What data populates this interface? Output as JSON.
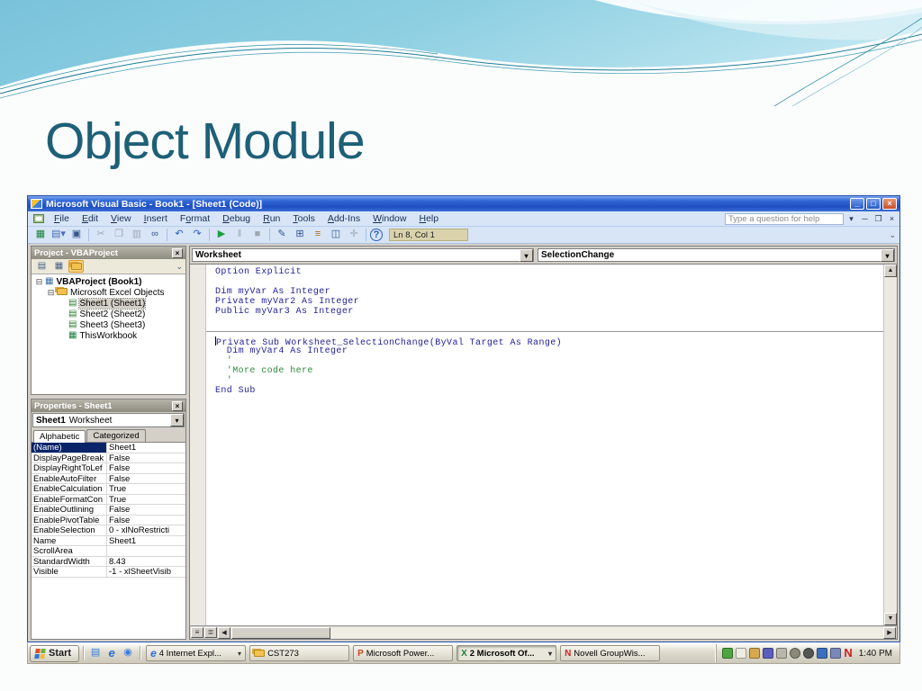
{
  "slide": {
    "title": "Object Module"
  },
  "colors": {
    "title_text": "#1d6077",
    "wave_blue_dark": "#6ab5d2",
    "wave_blue_light": "#bfe6f1",
    "wave_line": "#1f7d95",
    "titlebar_blue": "#1e4fc2",
    "menu_bg": "#d7e5f7",
    "panel_gray": "#d4d0c8",
    "code_keyword": "#22229a",
    "code_comment": "#2e8b3a",
    "selected_property": "#0a246a",
    "ln_box_bg": "#d9d2ab"
  },
  "vb": {
    "window_title": "Microsoft Visual Basic - Book1 - [Sheet1 (Code)]",
    "window_buttons": {
      "minimize": "_",
      "maximize": "□",
      "close": "×"
    },
    "menus": [
      {
        "label": "File",
        "u": 0
      },
      {
        "label": "Edit",
        "u": 0
      },
      {
        "label": "View",
        "u": 0
      },
      {
        "label": "Insert",
        "u": 0
      },
      {
        "label": "Format",
        "u": 1
      },
      {
        "label": "Debug",
        "u": 0
      },
      {
        "label": "Run",
        "u": 0
      },
      {
        "label": "Tools",
        "u": 0
      },
      {
        "label": "Add-Ins",
        "u": 0
      },
      {
        "label": "Window",
        "u": 0
      },
      {
        "label": "Help",
        "u": 0
      }
    ],
    "help_box_placeholder": "Type a question for help",
    "child_window_buttons": [
      "─",
      "❐",
      "×"
    ],
    "toolbar": {
      "buttons": [
        {
          "name": "view-excel-icon",
          "glyph": "▦",
          "color": "#1a7f3c",
          "enabled": true
        },
        {
          "name": "insert-userform-icon",
          "glyph": "▤",
          "color": "#4a6fb5",
          "enabled": true,
          "dropdown": true
        },
        {
          "name": "save-icon",
          "glyph": "▣",
          "color": "#35558a",
          "enabled": true
        },
        {
          "name": "cut-icon",
          "glyph": "✂",
          "color": "#444444",
          "enabled": false
        },
        {
          "name": "copy-icon",
          "glyph": "❐",
          "color": "#444444",
          "enabled": false
        },
        {
          "name": "paste-icon",
          "glyph": "▥",
          "color": "#444444",
          "enabled": false
        },
        {
          "name": "find-icon",
          "glyph": "∞",
          "color": "#35558a",
          "enabled": true
        },
        {
          "name": "undo-icon",
          "glyph": "↶",
          "color": "#2a5cc8",
          "enabled": true
        },
        {
          "name": "redo-icon",
          "glyph": "↷",
          "color": "#2a5cc8",
          "enabled": true
        },
        {
          "name": "run-icon",
          "glyph": "▶",
          "color": "#1e9e3e",
          "enabled": true
        },
        {
          "name": "break-icon",
          "glyph": "‖",
          "color": "#444444",
          "enabled": false
        },
        {
          "name": "reset-icon",
          "glyph": "■",
          "color": "#444444",
          "enabled": false
        },
        {
          "name": "design-mode-icon",
          "glyph": "✎",
          "color": "#35558a",
          "enabled": true
        },
        {
          "name": "project-explorer-icon",
          "glyph": "⊞",
          "color": "#35558a",
          "enabled": true
        },
        {
          "name": "properties-window-icon",
          "glyph": "≡",
          "color": "#b06a1a",
          "enabled": true
        },
        {
          "name": "object-browser-icon",
          "glyph": "◫",
          "color": "#35558a",
          "enabled": true
        },
        {
          "name": "toolbox-icon",
          "glyph": "✛",
          "color": "#444444",
          "enabled": false
        },
        {
          "name": "help-icon",
          "glyph": "?",
          "color": "#2a5cc8",
          "enabled": true
        }
      ],
      "status": "Ln 8, Col 1"
    },
    "project": {
      "title": "Project - VBAProject",
      "tools": [
        {
          "name": "view-code-icon",
          "glyph": "▤",
          "active": false
        },
        {
          "name": "view-object-icon",
          "glyph": "▦",
          "active": false
        },
        {
          "name": "toggle-folders-icon",
          "glyph": "folder",
          "active": true
        }
      ],
      "tree": [
        {
          "label": "VBAProject (Book1)",
          "icon": "project",
          "indent": 0,
          "expander": "⊟",
          "bold": true,
          "selected": false
        },
        {
          "label": "Microsoft Excel Objects",
          "icon": "folder",
          "indent": 1,
          "expander": "⊟",
          "bold": false,
          "selected": false
        },
        {
          "label": "Sheet1 (Sheet1)",
          "icon": "sheet",
          "indent": 2,
          "expander": "",
          "bold": false,
          "selected": true
        },
        {
          "label": "Sheet2 (Sheet2)",
          "icon": "sheet",
          "indent": 2,
          "expander": "",
          "bold": false,
          "selected": false
        },
        {
          "label": "Sheet3 (Sheet3)",
          "icon": "sheet",
          "indent": 2,
          "expander": "",
          "bold": false,
          "selected": false
        },
        {
          "label": "ThisWorkbook",
          "icon": "workbook",
          "indent": 2,
          "expander": "",
          "bold": false,
          "selected": false
        }
      ]
    },
    "properties": {
      "title": "Properties - Sheet1",
      "selector_name": "Sheet1",
      "selector_type": "Worksheet",
      "tabs": [
        "Alphabetic",
        "Categorized"
      ],
      "rows": [
        {
          "name": "(Name)",
          "value": "Sheet1",
          "selected": true
        },
        {
          "name": "DisplayPageBreak",
          "value": "False",
          "selected": false
        },
        {
          "name": "DisplayRightToLef",
          "value": "False",
          "selected": false
        },
        {
          "name": "EnableAutoFilter",
          "value": "False",
          "selected": false
        },
        {
          "name": "EnableCalculation",
          "value": "True",
          "selected": false
        },
        {
          "name": "EnableFormatCon",
          "value": "True",
          "selected": false
        },
        {
          "name": "EnableOutlining",
          "value": "False",
          "selected": false
        },
        {
          "name": "EnablePivotTable",
          "value": "False",
          "selected": false
        },
        {
          "name": "EnableSelection",
          "value": "0 - xlNoRestricti",
          "selected": false
        },
        {
          "name": "Name",
          "value": "Sheet1",
          "selected": false
        },
        {
          "name": "ScrollArea",
          "value": "",
          "selected": false
        },
        {
          "name": "StandardWidth",
          "value": "8.43",
          "selected": false
        },
        {
          "name": "Visible",
          "value": "-1 - xlSheetVisib",
          "selected": false
        }
      ]
    },
    "code_window": {
      "object_dropdown": "Worksheet",
      "event_dropdown": "SelectionChange",
      "lines": [
        {
          "text": "Option Explicit",
          "kind": "code",
          "cursor": false
        },
        {
          "text": "",
          "kind": "code",
          "cursor": false
        },
        {
          "text": "Dim myVar As Integer",
          "kind": "code",
          "cursor": false
        },
        {
          "text": "Private myVar2 As Integer",
          "kind": "code",
          "cursor": false
        },
        {
          "text": "Public myVar3 As Integer",
          "kind": "code",
          "cursor": false
        },
        {
          "text": "",
          "kind": "code",
          "cursor": false
        },
        {
          "text": "",
          "kind": "sep",
          "cursor": false
        },
        {
          "text": "Private Sub Worksheet_SelectionChange(ByVal Target As Range)",
          "kind": "code",
          "cursor": true
        },
        {
          "text": "  Dim myVar4 As Integer",
          "kind": "code",
          "cursor": false
        },
        {
          "text": "  '",
          "kind": "comment",
          "cursor": false
        },
        {
          "text": "  'More code here",
          "kind": "comment",
          "cursor": false
        },
        {
          "text": "  '",
          "kind": "comment",
          "cursor": false
        },
        {
          "text": "End Sub",
          "kind": "code",
          "cursor": false
        }
      ]
    }
  },
  "taskbar": {
    "start_label": "Start",
    "quick_launch": [
      {
        "name": "internet-document-icon",
        "glyph": "▤",
        "color": "#3a7de0"
      },
      {
        "name": "internet-explorer-icon",
        "glyph": "e",
        "color": "#2a6fd6"
      },
      {
        "name": "mail-icon",
        "glyph": "◉",
        "color": "#3a7de0"
      }
    ],
    "buttons": [
      {
        "label": "4 Internet Expl...",
        "icon_glyph": "e",
        "icon_color": "#2a6fd6",
        "dropdown": true,
        "active": false,
        "name": "task-button-internet-explorer"
      },
      {
        "label": "CST273",
        "icon_glyph": "folder",
        "icon_color": "#f2c14e",
        "dropdown": false,
        "active": false,
        "name": "task-button-cst273-folder"
      },
      {
        "label": "Microsoft Power...",
        "icon_glyph": "P",
        "icon_color": "#d0451f",
        "dropdown": false,
        "active": false,
        "name": "task-button-powerpoint"
      },
      {
        "label": "2 Microsoft Of...",
        "icon_glyph": "X",
        "icon_color": "#1a7f3c",
        "dropdown": true,
        "active": true,
        "name": "task-button-excel-group"
      },
      {
        "label": "Novell GroupWis...",
        "icon_glyph": "N",
        "icon_color": "#d11f1f",
        "dropdown": false,
        "active": false,
        "name": "task-button-novell-groupwise"
      }
    ],
    "tray_icons": [
      {
        "name": "tray-network-icon",
        "color": "#4da53f",
        "shape": "sq"
      },
      {
        "name": "tray-device-icon",
        "color": "#efece2",
        "shape": "sq"
      },
      {
        "name": "tray-display-icon",
        "color": "#d8a84e",
        "shape": "sq"
      },
      {
        "name": "tray-shield-icon",
        "color": "#5a5fbf",
        "shape": "sq"
      },
      {
        "name": "tray-printer-icon",
        "color": "#b9b6aa",
        "shape": "sq"
      },
      {
        "name": "tray-volume-icon",
        "color": "#8a8878",
        "shape": "round"
      },
      {
        "name": "tray-update-icon",
        "color": "#555555",
        "shape": "round"
      },
      {
        "name": "tray-app-icon",
        "color": "#3d6fc0",
        "shape": "sq"
      },
      {
        "name": "tray-connection-icon",
        "color": "#7a87b8",
        "shape": "sq"
      }
    ],
    "novell_letter": "N",
    "clock": "1:40 PM"
  }
}
